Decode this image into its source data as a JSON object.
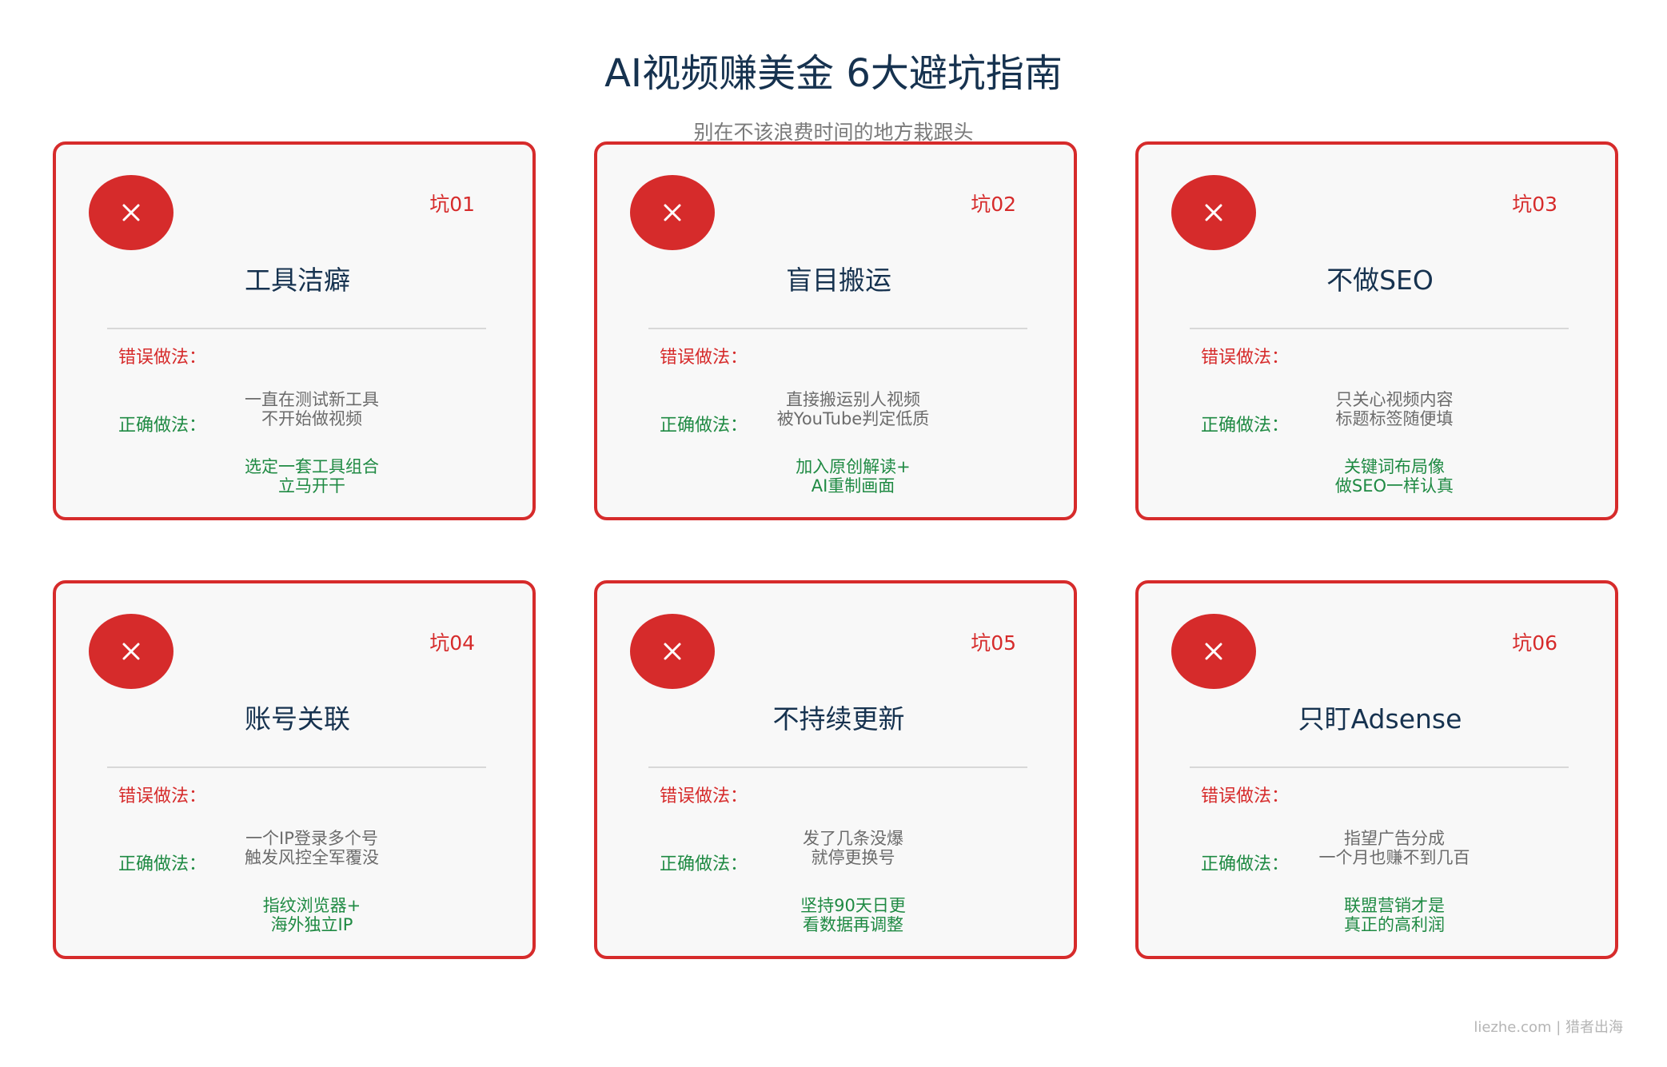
{
  "header": {
    "title": "AI视频赚美金 6大避坑指南",
    "subtitle": "别在不该浪费时间的地方栽跟头"
  },
  "labels": {
    "wrong": "错误做法：",
    "right": "正确做法："
  },
  "cards": [
    {
      "number": "坑01",
      "title": "工具洁癖",
      "wrong": [
        "一直在测试新工具",
        "不开始做视频"
      ],
      "right": [
        "选定一套工具组合",
        "立马开干"
      ]
    },
    {
      "number": "坑02",
      "title": "盲目搬运",
      "wrong": [
        "直接搬运别人视频",
        "被YouTube判定低质"
      ],
      "right": [
        "加入原创解读+",
        "AI重制画面"
      ]
    },
    {
      "number": "坑03",
      "title": "不做SEO",
      "wrong": [
        "只关心视频内容",
        "标题标签随便填"
      ],
      "right": [
        "关键词布局像",
        "做SEO一样认真"
      ]
    },
    {
      "number": "坑04",
      "title": "账号关联",
      "wrong": [
        "一个IP登录多个号",
        "触发风控全军覆没"
      ],
      "right": [
        "指纹浏览器+",
        "海外独立IP"
      ]
    },
    {
      "number": "坑05",
      "title": "不持续更新",
      "wrong": [
        "发了几条没爆",
        "就停更换号"
      ],
      "right": [
        "坚持90天日更",
        "看数据再调整"
      ]
    },
    {
      "number": "坑06",
      "title": "只盯Adsense",
      "wrong": [
        "指望广告分成",
        "一个月也赚不到几百"
      ],
      "right": [
        "联盟营销才是",
        "真正的高利润"
      ]
    }
  ],
  "footer": {
    "text": "liezhe.com | 猎者出海"
  },
  "colors": {
    "accent_red": "#d62b2b",
    "right_green": "#1f8a43",
    "title_navy": "#16324f",
    "card_bg": "#f8f8f8"
  },
  "icons": {
    "card_badge": "close-icon"
  }
}
